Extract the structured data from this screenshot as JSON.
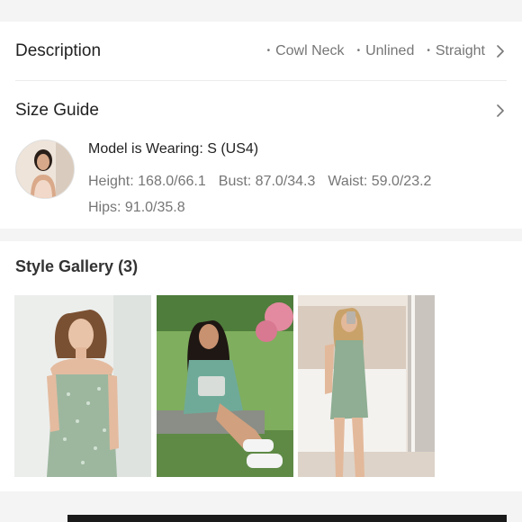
{
  "description": {
    "title": "Description",
    "tags": [
      "Cowl Neck",
      "Unlined",
      "Straight"
    ]
  },
  "size_guide": {
    "title": "Size Guide",
    "model_wearing": "Model is Wearing: S (US4)",
    "height": "Height: 168.0/66.1",
    "bust": "Bust: 87.0/34.3",
    "waist": "Waist: 59.0/23.2",
    "hips": "Hips: 91.0/35.8"
  },
  "gallery": {
    "title": "Style Gallery (3)",
    "photos": [
      {
        "alt": "Model in sage green floral cowl neck mini dress"
      },
      {
        "alt": "Model seated outdoors in green floral dress with handbag"
      },
      {
        "alt": "Mirror selfie in green floral slip dress"
      }
    ]
  },
  "colors": {
    "page_background": "#f4f4f4",
    "card_background": "#ffffff",
    "text_primary": "#222222",
    "text_secondary": "#767676",
    "dress_green": "#8fae93"
  },
  "icons": {
    "chevron": "chevron-right-icon"
  }
}
